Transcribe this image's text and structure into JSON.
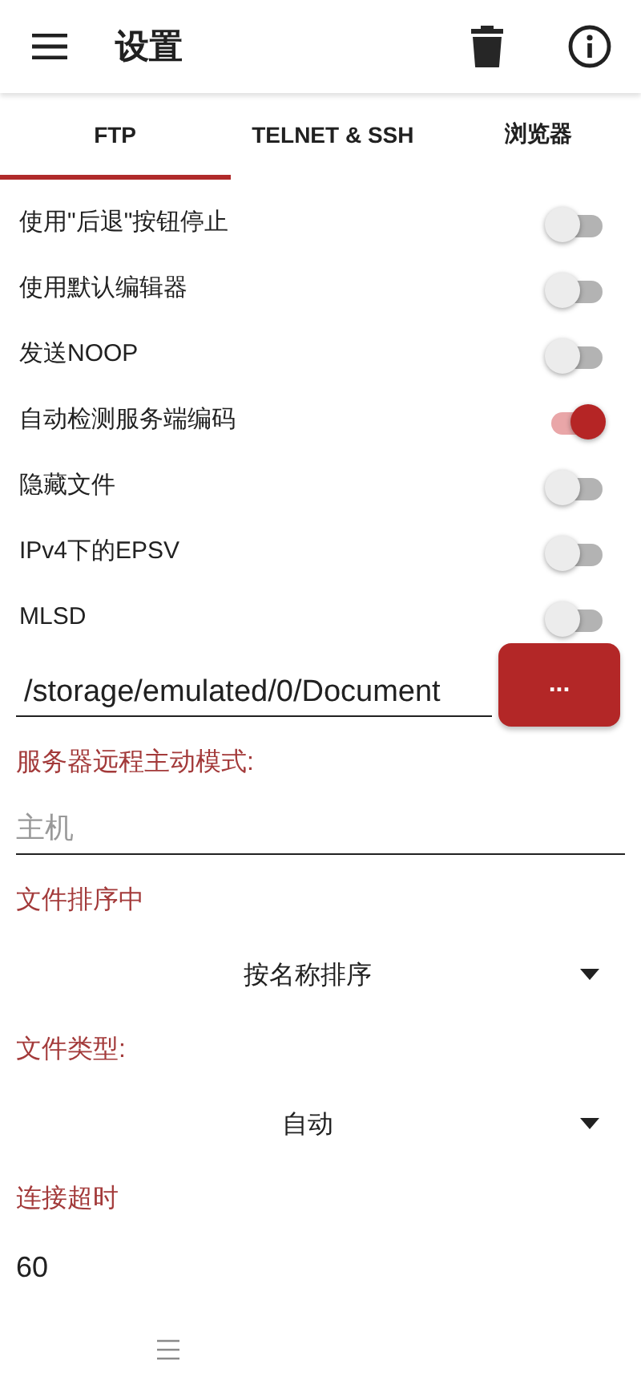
{
  "app_bar": {
    "title": "设置"
  },
  "tabs": [
    {
      "label": "FTP",
      "selected": true
    },
    {
      "label": "TELNET & SSH",
      "selected": false
    },
    {
      "label": "浏览器",
      "selected": false
    }
  ],
  "switches": [
    {
      "label": "使用\"后退\"按钮停止",
      "on": false
    },
    {
      "label": "使用默认编辑器",
      "on": false
    },
    {
      "label": "发送NOOP",
      "on": false
    },
    {
      "label": "自动检测服务端编码",
      "on": true
    },
    {
      "label": "隐藏文件",
      "on": false
    },
    {
      "label": "IPv4下的EPSV",
      "on": false
    },
    {
      "label": "MLSD",
      "on": false
    }
  ],
  "path_field": {
    "value": "/storage/emulated/0/Document",
    "button": "..."
  },
  "active_mode": {
    "label": "服务器远程主动模式:",
    "host": {
      "placeholder": "主机"
    }
  },
  "sort": {
    "label": "文件排序中",
    "value": "按名称排序"
  },
  "file_type": {
    "label": "文件类型:",
    "value": "自动"
  },
  "timeout": {
    "label": "连接超时",
    "value": "60"
  }
}
